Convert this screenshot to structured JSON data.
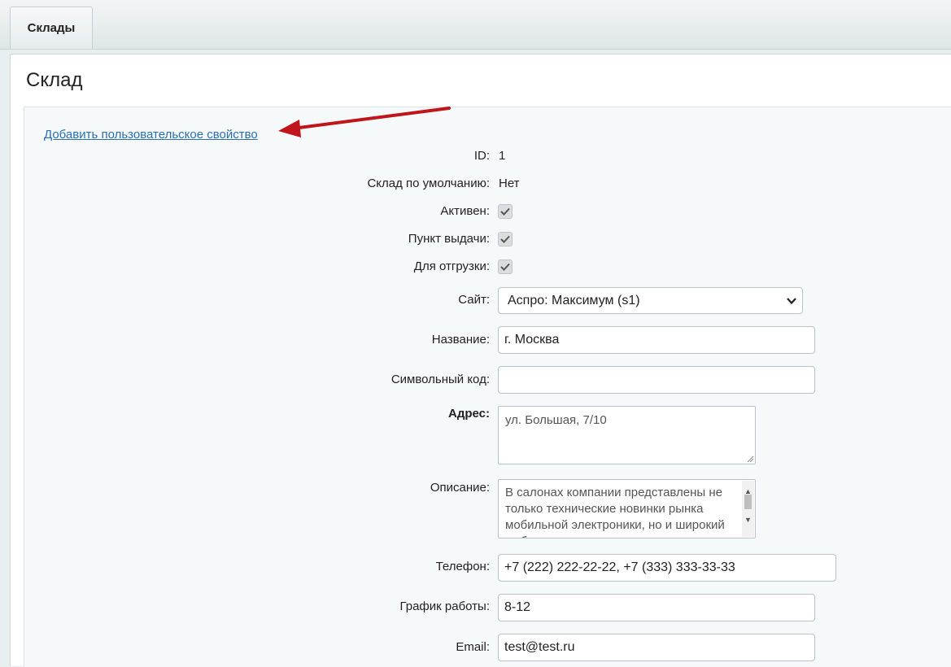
{
  "tabs": [
    {
      "label": "Склады"
    }
  ],
  "page": {
    "title": "Склад"
  },
  "add_property_link": "Добавить пользовательское свойство",
  "fields": {
    "id": {
      "label": "ID:",
      "value": "1"
    },
    "default_store": {
      "label": "Склад по умолчанию:",
      "value": "Нет"
    },
    "active": {
      "label": "Активен:",
      "checked": true
    },
    "pickup_point": {
      "label": "Пункт выдачи:",
      "checked": true
    },
    "shipping": {
      "label": "Для отгрузки:",
      "checked": true
    },
    "site": {
      "label": "Сайт:",
      "selected": "Аспро: Максимум (s1)"
    },
    "name": {
      "label": "Название:",
      "value": "г. Москва"
    },
    "code": {
      "label": "Символьный код:",
      "value": ""
    },
    "address": {
      "label": "Адрес:",
      "value": "ул. Большая, 7/10"
    },
    "description": {
      "label": "Описание:",
      "value": "В салонах компании представлены не только технические новинки рынка мобильной электроники, но и широкий выбор дополнительных"
    },
    "phone": {
      "label": "Телефон:",
      "value": "+7 (222) 222-22-22, +7 (333) 333-33-33"
    },
    "schedule": {
      "label": "График работы:",
      "value": "8-12"
    },
    "email": {
      "label": "Email:",
      "value": "test@test.ru"
    }
  },
  "colors": {
    "link": "#2b6fb6",
    "annotation_arrow": "#c0151b"
  },
  "icons": {
    "select_arrow": "chevron-down-icon",
    "checkbox": "checkmark-icon"
  }
}
